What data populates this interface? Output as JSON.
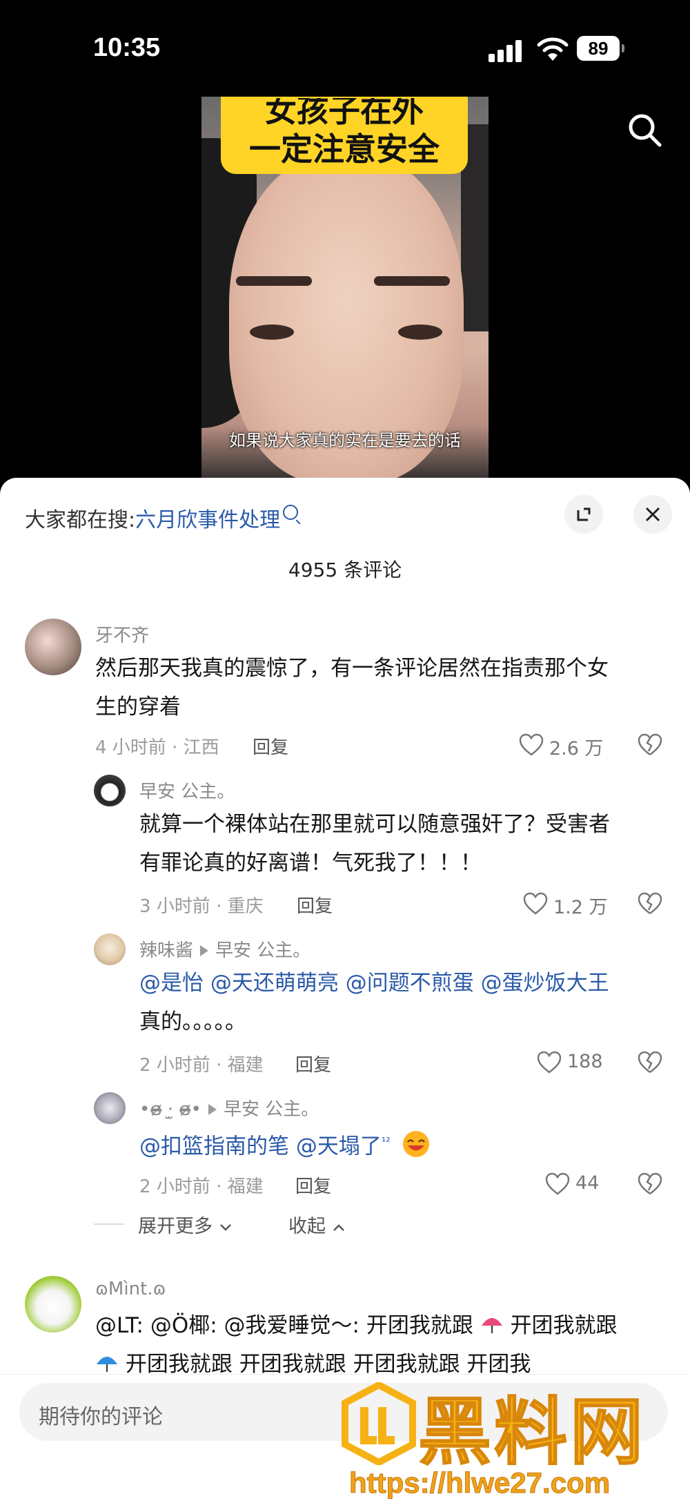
{
  "status": {
    "time": "10:35",
    "battery": "89"
  },
  "video": {
    "banner_line1": "女孩子在外",
    "banner_line2": "一定注意安全",
    "subtitle": "如果说大家真的实在是要去的话"
  },
  "sheet": {
    "hot_search_prefix": "大家都在搜:",
    "hot_search_term": "六月欣事件处理",
    "comment_count": "4955 条评论"
  },
  "comments": [
    {
      "user": "牙不齐",
      "text_line1": "然后那天我真的震惊了，有一条评论居然在指责那个女",
      "text_line2": "生的穿着",
      "meta": "4 小时前 · 江西",
      "reply": "回复",
      "likes": "2.6 万"
    },
    {
      "user": "早安  公主。",
      "text_line1": "就算一个裸体站在那里就可以随意强奸了？受害者",
      "text_line2": "有罪论真的好离谱！气死我了！！！",
      "meta": "3 小时前 · 重庆",
      "reply": "回复",
      "likes": "1.2 万"
    },
    {
      "user": "辣味酱",
      "reply_to": "早安  公主。",
      "mentions": [
        "@是怡",
        "@天还萌萌亮",
        "@问题不煎蛋",
        "@蛋炒饭大王"
      ],
      "text_line2": "真的。。。。。",
      "meta": "2 小时前 · 福建",
      "reply": "回复",
      "likes": "188"
    },
    {
      "user": "•ɞ̴̶̷ ·̫ ɞ̴̶̷•",
      "reply_to": "早安  公主。",
      "mentions": [
        "@扣篮指南的笔",
        "@天塌了"
      ],
      "sup": "¹²",
      "meta": "2 小时前 · 福建",
      "reply": "回复",
      "likes": "44"
    },
    {
      "user": "ɷMìnt.ɷ",
      "text_line1": "@LT: @Ö椰: @我爱睡觉～: 开团我就跟",
      "text_line1b": "开团我就跟",
      "text_line2": "开团我就跟  开团我就跟  开团我就跟  开团我"
    }
  ],
  "expand": {
    "more": "展开更多",
    "collapse": "收起"
  },
  "input": {
    "placeholder": "期待你的评论"
  },
  "watermark": {
    "title": "黑料网",
    "url": "https://hlwe27.com"
  }
}
